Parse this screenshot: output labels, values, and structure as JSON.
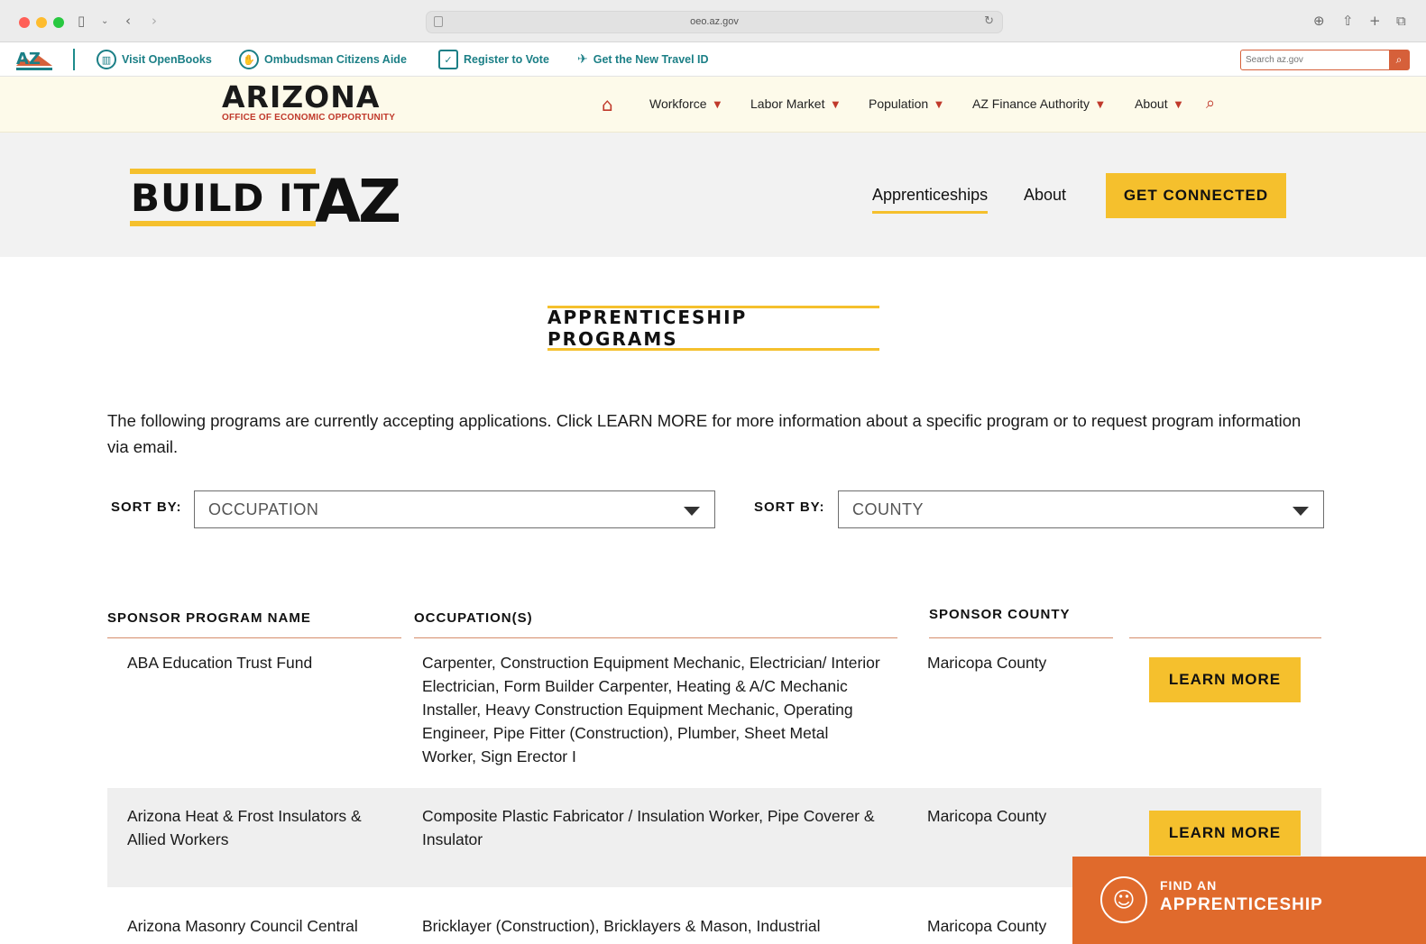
{
  "browser": {
    "url": "oeo.az.gov",
    "colors": {
      "close": "#ff5f57",
      "minimize": "#febc2e",
      "maximize": "#28c840"
    }
  },
  "utility_bar": {
    "logo_text": "AZ",
    "links": [
      {
        "label": "Visit OpenBooks",
        "icon": "book-icon"
      },
      {
        "label": "Ombudsman Citizens Aide",
        "icon": "hand-icon"
      },
      {
        "label": "Register to Vote",
        "icon": "ballot-icon"
      },
      {
        "label": "Get the New Travel ID",
        "icon": "plane-icon"
      }
    ],
    "search_placeholder": "Search az.gov"
  },
  "oeo_nav": {
    "logo_word": "ARIZONA",
    "logo_sub": "OFFICE OF ECONOMIC OPPORTUNITY",
    "items": [
      "Workforce",
      "Labor Market",
      "Population",
      "AZ Finance Authority",
      "About"
    ]
  },
  "site_header": {
    "logo_build": "BUILD IT",
    "logo_az": "AZ",
    "nav": [
      "Apprenticeships",
      "About"
    ],
    "active_nav": "Apprenticeships",
    "cta": "GET CONNECTED"
  },
  "main": {
    "title": "APPRENTICESHIP PROGRAMS",
    "intro": "The following programs are currently accepting applications. Click LEARN MORE for more information about a specific program or to request program information via email.",
    "sort": [
      {
        "label": "SORT BY:",
        "value": "OCCUPATION"
      },
      {
        "label": "SORT BY:",
        "value": "COUNTY"
      }
    ],
    "table": {
      "headers": [
        "SPONSOR PROGRAM NAME",
        "OCCUPATION(S)",
        "SPONSOR COUNTY"
      ],
      "action_label": "LEARN MORE",
      "rows": [
        {
          "name": "ABA Education Trust Fund",
          "occupations": "Carpenter, Construction Equipment Mechanic, Electrician/ Interior Electrician, Form Builder Carpenter, Heating & A/C Mechanic Installer, Heavy Construction Equipment Mechanic, Operating Engineer, Pipe Fitter (Construction), Plumber, Sheet Metal Worker, Sign Erector I",
          "county": "Maricopa County"
        },
        {
          "name": "Arizona Heat & Frost Insulators & Allied Workers",
          "occupations": "Composite Plastic Fabricator / Insulation Worker, Pipe Coverer & Insulator",
          "county": "Maricopa County"
        },
        {
          "name": "Arizona Masonry Council Central",
          "occupations": "Bricklayer (Construction), Bricklayers & Mason, Industrial",
          "county": "Maricopa County"
        }
      ]
    }
  },
  "find_banner": {
    "line1": "FIND AN",
    "line2": "APPRENTICESHIP"
  },
  "theme": {
    "yellow": "#f5c02d",
    "orange": "#e06a2c",
    "red": "#c0392b",
    "teal": "#1b7f86"
  }
}
